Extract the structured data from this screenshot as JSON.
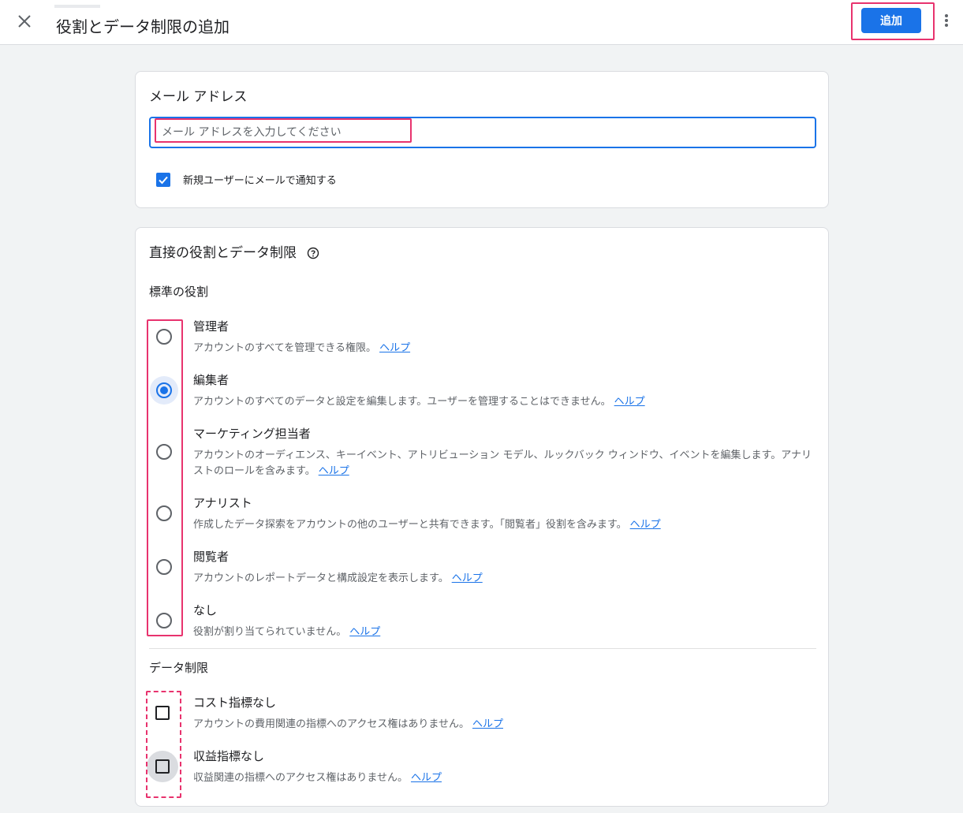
{
  "header": {
    "title": "役割とデータ制限の追加",
    "add_button": "追加"
  },
  "email_section": {
    "title": "メール アドレス",
    "placeholder": "メール アドレスを入力してください",
    "notify_label": "新規ユーザーにメールで通知する",
    "notify_checked": true
  },
  "roles_section": {
    "title": "直接の役割とデータ制限",
    "standard_roles_label": "標準の役割",
    "help_link": "ヘルプ",
    "roles": [
      {
        "name": "管理者",
        "desc": "アカウントのすべてを管理できる権限。",
        "selected": false
      },
      {
        "name": "編集者",
        "desc": "アカウントのすべてのデータと設定を編集します。ユーザーを管理することはできません。",
        "selected": true
      },
      {
        "name": "マーケティング担当者",
        "desc": "アカウントのオーディエンス、キーイベント、アトリビューション モデル、ルックバック ウィンドウ、イベントを編集します。アナリストのロールを含みます。",
        "selected": false
      },
      {
        "name": "アナリスト",
        "desc": "作成したデータ探索をアカウントの他のユーザーと共有できます。「閲覧者」役割を含みます。",
        "selected": false
      },
      {
        "name": "閲覧者",
        "desc": "アカウントのレポートデータと構成設定を表示します。",
        "selected": false
      },
      {
        "name": "なし",
        "desc": "役割が割り当てられていません。",
        "selected": false
      }
    ],
    "data_restrictions_label": "データ制限",
    "restrictions": [
      {
        "name": "コスト指標なし",
        "desc": "アカウントの費用関連の指標へのアクセス権はありません。",
        "checked": false
      },
      {
        "name": "収益指標なし",
        "desc": "収益関連の指標へのアクセス権はありません。",
        "checked": false
      }
    ]
  },
  "colors": {
    "accent": "#1a73e8",
    "highlight": "#e8336e"
  }
}
